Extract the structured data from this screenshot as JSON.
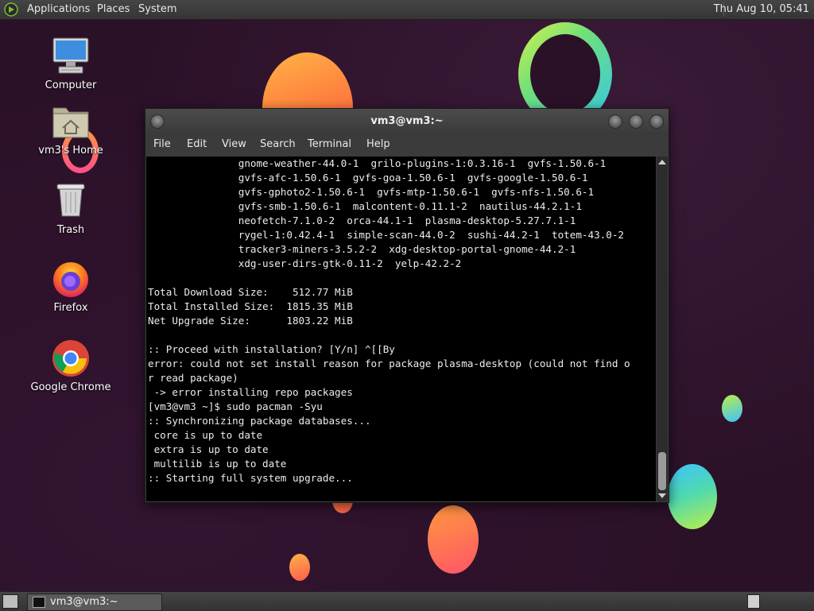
{
  "top_panel": {
    "menus": [
      "Applications",
      "Places",
      "System"
    ],
    "clock": "Thu Aug 10, 05:41"
  },
  "desktop_icons": [
    {
      "label": "Computer",
      "icon": "computer-icon"
    },
    {
      "label": "vm3's Home",
      "icon": "home-folder-icon"
    },
    {
      "label": "Trash",
      "icon": "trash-icon"
    },
    {
      "label": "Firefox",
      "icon": "firefox-icon"
    },
    {
      "label": "Google Chrome",
      "icon": "chrome-icon"
    }
  ],
  "terminal": {
    "title": "vm3@vm3:~",
    "menu": [
      "File",
      "Edit",
      "View",
      "Search",
      "Terminal",
      "Help"
    ],
    "lines": [
      "               gnome-weather-44.0-1  grilo-plugins-1:0.3.16-1  gvfs-1.50.6-1",
      "               gvfs-afc-1.50.6-1  gvfs-goa-1.50.6-1  gvfs-google-1.50.6-1",
      "               gvfs-gphoto2-1.50.6-1  gvfs-mtp-1.50.6-1  gvfs-nfs-1.50.6-1",
      "               gvfs-smb-1.50.6-1  malcontent-0.11.1-2  nautilus-44.2.1-1",
      "               neofetch-7.1.0-2  orca-44.1-1  plasma-desktop-5.27.7.1-1",
      "               rygel-1:0.42.4-1  simple-scan-44.0-2  sushi-44.2-1  totem-43.0-2",
      "               tracker3-miners-3.5.2-2  xdg-desktop-portal-gnome-44.2-1",
      "               xdg-user-dirs-gtk-0.11-2  yelp-42.2-2",
      "",
      "Total Download Size:    512.77 MiB",
      "Total Installed Size:  1815.35 MiB",
      "Net Upgrade Size:      1803.22 MiB",
      "",
      ":: Proceed with installation? [Y/n] ^[[By",
      "error: could not set install reason for package plasma-desktop (could not find o",
      "r read package)",
      " -> error installing repo packages",
      "[vm3@vm3 ~]$ sudo pacman -Syu",
      ":: Synchronizing package databases...",
      " core is up to date",
      " extra is up to date",
      " multilib is up to date",
      ":: Starting full system upgrade..."
    ]
  },
  "taskbar": {
    "task_label": "vm3@vm3:~"
  }
}
